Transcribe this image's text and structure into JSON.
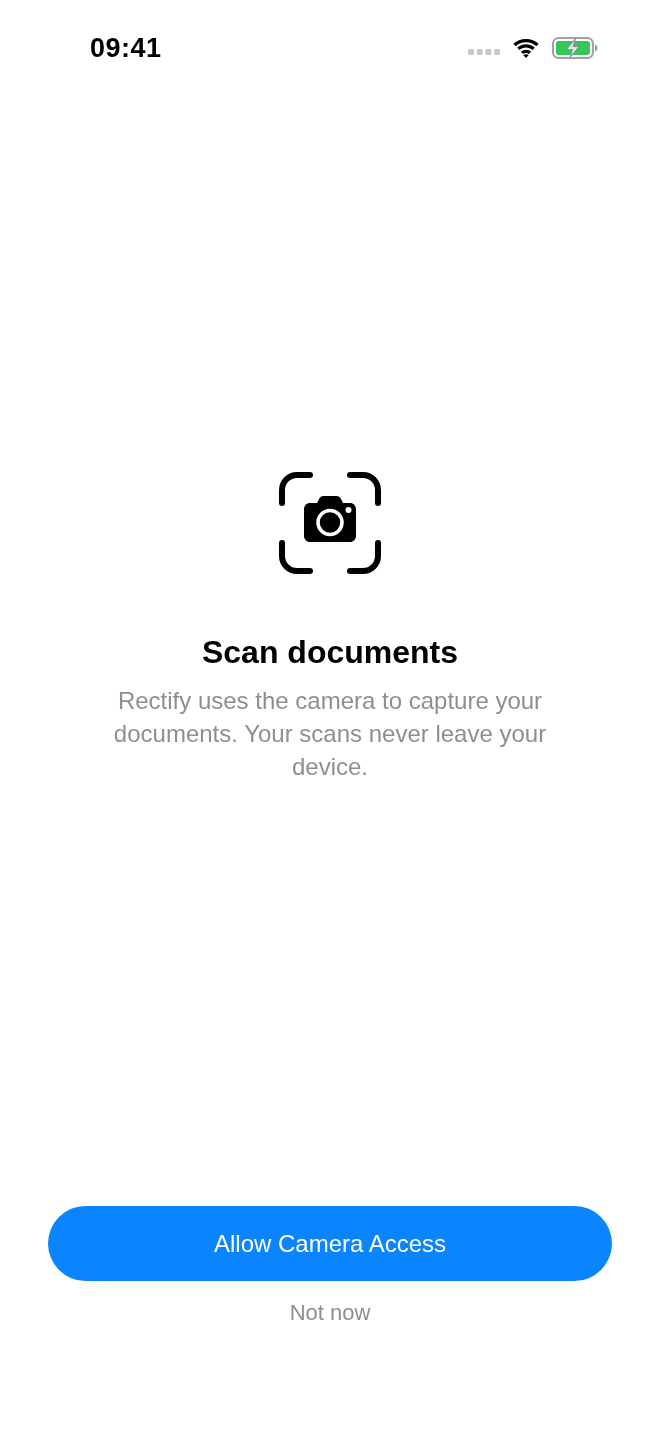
{
  "status_bar": {
    "time": "09:41"
  },
  "permission": {
    "title": "Scan documents",
    "body": "Rectify uses the camera to capture your documents. Your scans never leave your device."
  },
  "actions": [
    {
      "kind": "primary",
      "label": "Allow Camera Access"
    },
    {
      "kind": "secondary",
      "label": "Not now"
    }
  ]
}
